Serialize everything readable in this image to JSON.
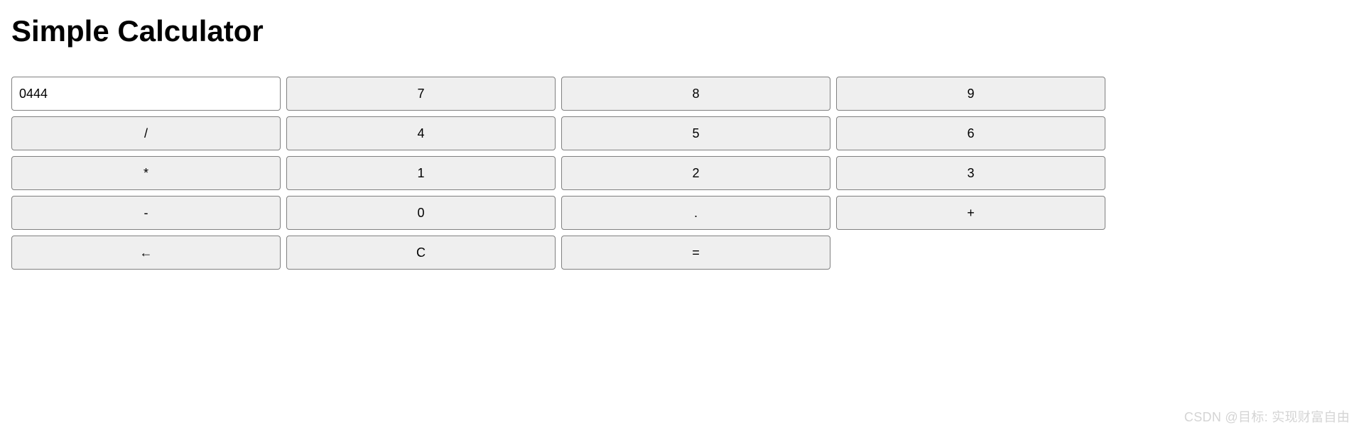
{
  "title": "Simple Calculator",
  "display_value": "0444",
  "buttons": {
    "b7": "7",
    "b8": "8",
    "b9": "9",
    "divide": "/",
    "b4": "4",
    "b5": "5",
    "b6": "6",
    "multiply": "*",
    "b1": "1",
    "b2": "2",
    "b3": "3",
    "minus": "-",
    "b0": "0",
    "dot": ".",
    "plus": "+",
    "back": "←",
    "clear": "C",
    "equals": "="
  },
  "watermark": "CSDN @目标: 实现财富自由"
}
